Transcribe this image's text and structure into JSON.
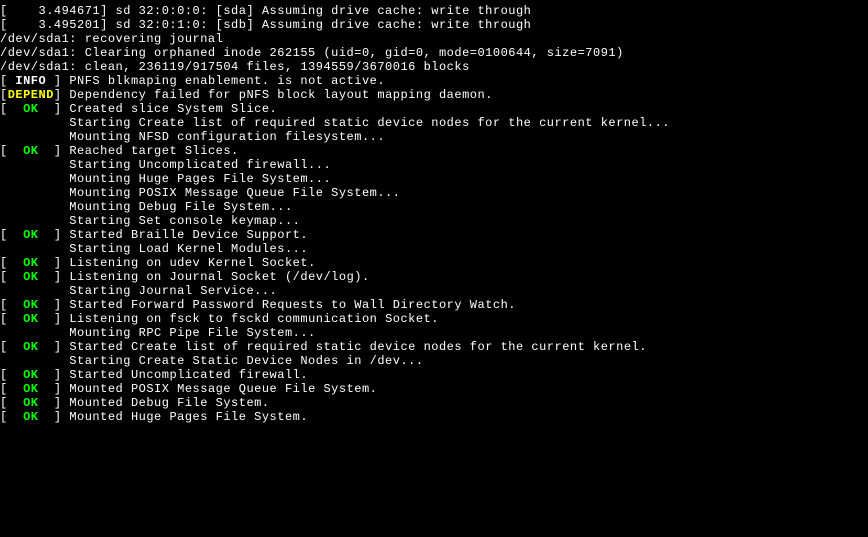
{
  "lines": [
    {
      "type": "plain",
      "text": "[    3.494671] sd 32:0:0:0: [sda] Assuming drive cache: write through"
    },
    {
      "type": "plain",
      "text": "[    3.495201] sd 32:0:1:0: [sdb] Assuming drive cache: write through"
    },
    {
      "type": "plain",
      "text": "/dev/sda1: recovering journal"
    },
    {
      "type": "plain",
      "text": "/dev/sda1: Clearing orphaned inode 262155 (uid=0, gid=0, mode=0100644, size=7091)"
    },
    {
      "type": "plain",
      "text": "/dev/sda1: clean, 236119/917504 files, 1394559/3670016 blocks"
    },
    {
      "type": "status",
      "status": " INFO ",
      "class": "info",
      "msg": "PNFS blkmaping enablement. is not active."
    },
    {
      "type": "status",
      "status": "DEPEND",
      "class": "depend",
      "msg": "Dependency failed for pNFS block layout mapping daemon."
    },
    {
      "type": "status",
      "status": "  OK  ",
      "class": "ok",
      "msg": "Created slice System Slice."
    },
    {
      "type": "indent",
      "text": "         Starting Create list of required static device nodes for the current kernel..."
    },
    {
      "type": "indent",
      "text": "         Mounting NFSD configuration filesystem..."
    },
    {
      "type": "status",
      "status": "  OK  ",
      "class": "ok",
      "msg": "Reached target Slices."
    },
    {
      "type": "indent",
      "text": "         Starting Uncomplicated firewall..."
    },
    {
      "type": "indent",
      "text": "         Mounting Huge Pages File System..."
    },
    {
      "type": "indent",
      "text": "         Mounting POSIX Message Queue File System..."
    },
    {
      "type": "indent",
      "text": "         Mounting Debug File System..."
    },
    {
      "type": "indent",
      "text": "         Starting Set console keymap..."
    },
    {
      "type": "status",
      "status": "  OK  ",
      "class": "ok",
      "msg": "Started Braille Device Support."
    },
    {
      "type": "indent",
      "text": "         Starting Load Kernel Modules..."
    },
    {
      "type": "status",
      "status": "  OK  ",
      "class": "ok",
      "msg": "Listening on udev Kernel Socket."
    },
    {
      "type": "status",
      "status": "  OK  ",
      "class": "ok",
      "msg": "Listening on Journal Socket (/dev/log)."
    },
    {
      "type": "indent",
      "text": "         Starting Journal Service..."
    },
    {
      "type": "status",
      "status": "  OK  ",
      "class": "ok",
      "msg": "Started Forward Password Requests to Wall Directory Watch."
    },
    {
      "type": "status",
      "status": "  OK  ",
      "class": "ok",
      "msg": "Listening on fsck to fsckd communication Socket."
    },
    {
      "type": "indent",
      "text": "         Mounting RPC Pipe File System..."
    },
    {
      "type": "status",
      "status": "  OK  ",
      "class": "ok",
      "msg": "Started Create list of required static device nodes for the current kernel."
    },
    {
      "type": "indent",
      "text": "         Starting Create Static Device Nodes in /dev..."
    },
    {
      "type": "status",
      "status": "  OK  ",
      "class": "ok",
      "msg": "Started Uncomplicated firewall."
    },
    {
      "type": "status",
      "status": "  OK  ",
      "class": "ok",
      "msg": "Mounted POSIX Message Queue File System."
    },
    {
      "type": "status",
      "status": "  OK  ",
      "class": "ok",
      "msg": "Mounted Debug File System."
    },
    {
      "type": "status",
      "status": "  OK  ",
      "class": "ok",
      "msg": "Mounted Huge Pages File System."
    }
  ]
}
